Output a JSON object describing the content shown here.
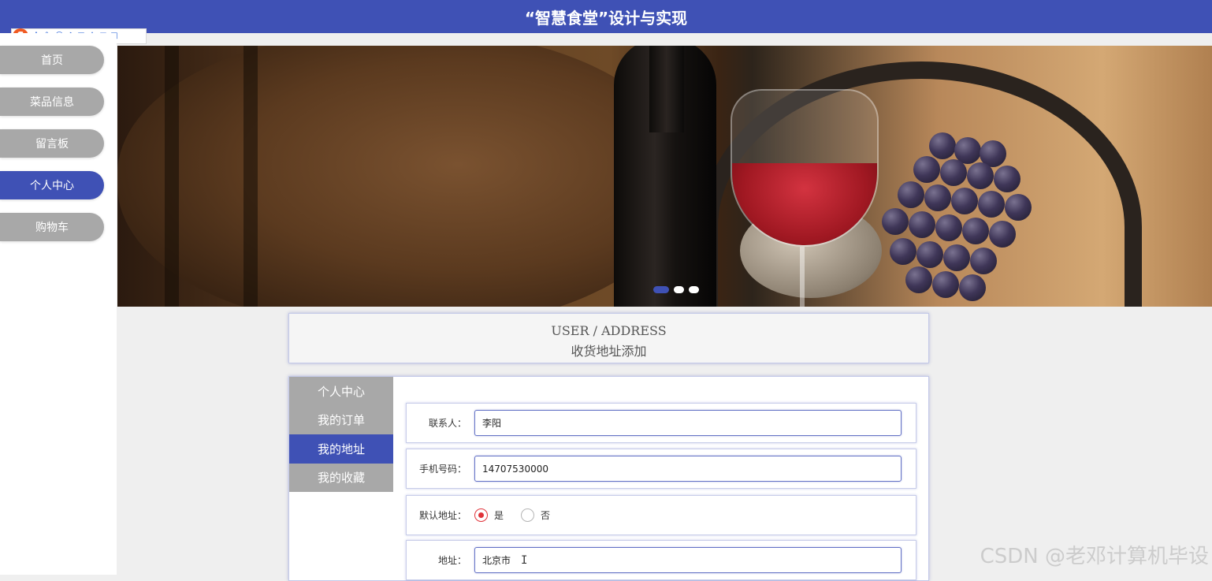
{
  "header": {
    "title": "“智慧食堂”设计与实现"
  },
  "ime_toolbar": {
    "logo": "S",
    "mode": "中",
    "punct": "°,",
    "icons": [
      "emoji-icon",
      "microphone-icon",
      "keyboard-icon",
      "user-icon",
      "shirt-icon",
      "grid-icon"
    ]
  },
  "sidebar": {
    "items": [
      {
        "label": "首页",
        "active": false
      },
      {
        "label": "菜品信息",
        "active": false
      },
      {
        "label": "留言板",
        "active": false
      },
      {
        "label": "个人中心",
        "active": true
      },
      {
        "label": "购物车",
        "active": false
      }
    ]
  },
  "banner": {
    "slide_count": 3,
    "active_slide": 1
  },
  "section_title": {
    "en": "USER / ADDRESS",
    "cn": "收货地址添加"
  },
  "user_menu": {
    "items": [
      {
        "label": "个人中心",
        "active": false
      },
      {
        "label": "我的订单",
        "active": false
      },
      {
        "label": "我的地址",
        "active": true
      },
      {
        "label": "我的收藏",
        "active": false
      }
    ]
  },
  "form": {
    "contact_label": "联系人：",
    "contact_value": "李阳",
    "phone_label": "手机号码：",
    "phone_value": "14707530000",
    "default_label": "默认地址：",
    "default_yes": "是",
    "default_no": "否",
    "default_selected": "是",
    "address_label": "地址：",
    "address_value": "北京市"
  },
  "watermark": "CSDN @老邓计算机毕设",
  "colors": {
    "primary": "#3f51b5",
    "inactive": "#a8a8a8",
    "radio_checked": "#e0333a"
  }
}
